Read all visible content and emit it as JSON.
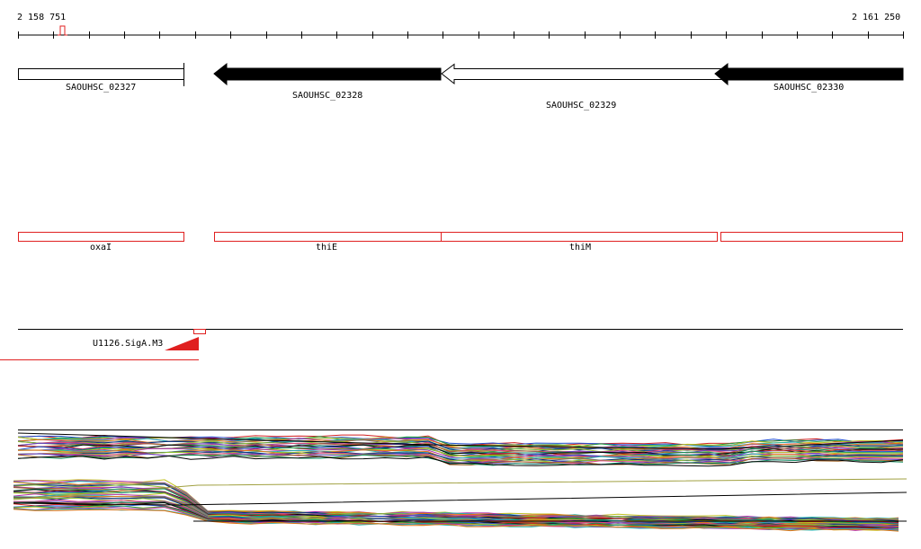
{
  "ruler": {
    "start_label": "2 158 751",
    "end_label": "2 161 250"
  },
  "genes": [
    {
      "id": "SAOUHSC_02327",
      "strand": "+",
      "fill": "white"
    },
    {
      "id": "SAOUHSC_02328",
      "strand": "-",
      "fill": "black"
    },
    {
      "id": "SAOUHSC_02329",
      "strand": "-",
      "fill": "white"
    },
    {
      "id": "SAOUHSC_02330",
      "strand": "-",
      "fill": "black"
    }
  ],
  "annotations": [
    {
      "name": "oxaI"
    },
    {
      "name": "thiE"
    },
    {
      "name": "thiM"
    },
    {
      "name": ""
    }
  ],
  "promoter": {
    "name": "U1126.SigA.M3"
  },
  "colors": {
    "annotation": "#e02020",
    "gene_fill_dark": "#000000",
    "gene_outline": "#000000",
    "ruler_marker": "#e02020"
  }
}
